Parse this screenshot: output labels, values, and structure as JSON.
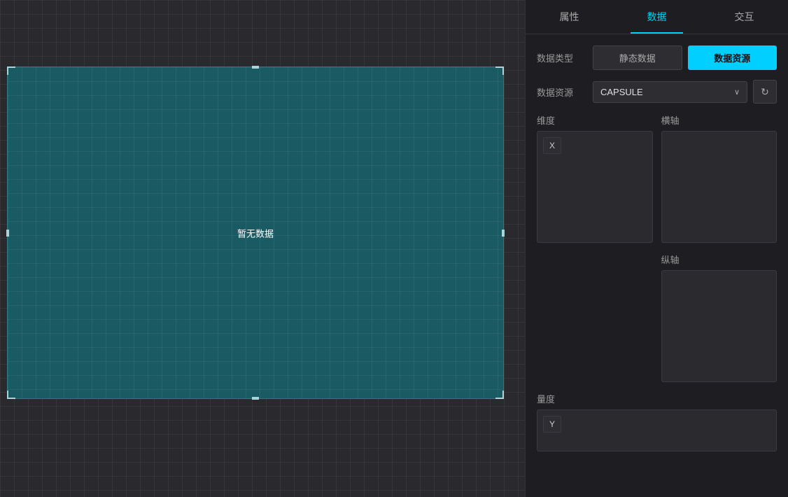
{
  "tabs": {
    "items": [
      {
        "id": "properties",
        "label": "属性"
      },
      {
        "id": "data",
        "label": "数据"
      },
      {
        "id": "interaction",
        "label": "交互"
      }
    ],
    "active": "data"
  },
  "panel": {
    "data_type_label": "数据类型",
    "static_data_label": "静态数据",
    "data_source_label": "数据资源",
    "data_source_active_label": "数据资源",
    "datasource_name": "CAPSULE",
    "datasource_chevron": "∨",
    "refresh_icon": "↻",
    "dimension_label": "维度",
    "x_axis_label": "X",
    "horizontal_axis_label": "横轴",
    "vertical_axis_label": "纵轴",
    "y_axis_label": "Y",
    "measure_label": "量度"
  },
  "canvas": {
    "no_data_text": "暂无数据"
  },
  "colors": {
    "accent": "#00cfff",
    "chart_bg": "#1a5a63",
    "panel_bg": "#1e1e22",
    "canvas_bg": "#2a2a2e",
    "active_tab_color": "#00cfff"
  }
}
